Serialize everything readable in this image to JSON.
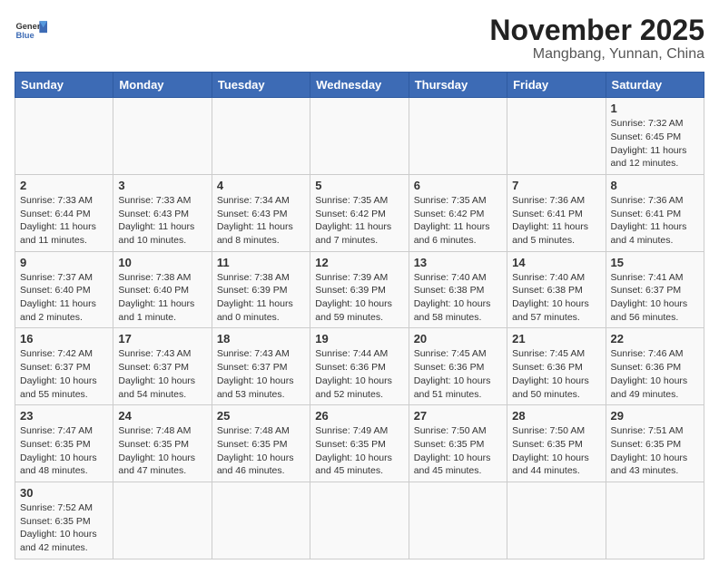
{
  "header": {
    "logo_general": "General",
    "logo_blue": "Blue",
    "month": "November 2025",
    "location": "Mangbang, Yunnan, China"
  },
  "days_of_week": [
    "Sunday",
    "Monday",
    "Tuesday",
    "Wednesday",
    "Thursday",
    "Friday",
    "Saturday"
  ],
  "weeks": [
    [
      {
        "day": "",
        "info": ""
      },
      {
        "day": "",
        "info": ""
      },
      {
        "day": "",
        "info": ""
      },
      {
        "day": "",
        "info": ""
      },
      {
        "day": "",
        "info": ""
      },
      {
        "day": "",
        "info": ""
      },
      {
        "day": "1",
        "info": "Sunrise: 7:32 AM\nSunset: 6:45 PM\nDaylight: 11 hours and 12 minutes."
      }
    ],
    [
      {
        "day": "2",
        "info": "Sunrise: 7:33 AM\nSunset: 6:44 PM\nDaylight: 11 hours and 11 minutes."
      },
      {
        "day": "3",
        "info": "Sunrise: 7:33 AM\nSunset: 6:43 PM\nDaylight: 11 hours and 10 minutes."
      },
      {
        "day": "4",
        "info": "Sunrise: 7:34 AM\nSunset: 6:43 PM\nDaylight: 11 hours and 8 minutes."
      },
      {
        "day": "5",
        "info": "Sunrise: 7:35 AM\nSunset: 6:42 PM\nDaylight: 11 hours and 7 minutes."
      },
      {
        "day": "6",
        "info": "Sunrise: 7:35 AM\nSunset: 6:42 PM\nDaylight: 11 hours and 6 minutes."
      },
      {
        "day": "7",
        "info": "Sunrise: 7:36 AM\nSunset: 6:41 PM\nDaylight: 11 hours and 5 minutes."
      },
      {
        "day": "8",
        "info": "Sunrise: 7:36 AM\nSunset: 6:41 PM\nDaylight: 11 hours and 4 minutes."
      }
    ],
    [
      {
        "day": "9",
        "info": "Sunrise: 7:37 AM\nSunset: 6:40 PM\nDaylight: 11 hours and 2 minutes."
      },
      {
        "day": "10",
        "info": "Sunrise: 7:38 AM\nSunset: 6:40 PM\nDaylight: 11 hours and 1 minute."
      },
      {
        "day": "11",
        "info": "Sunrise: 7:38 AM\nSunset: 6:39 PM\nDaylight: 11 hours and 0 minutes."
      },
      {
        "day": "12",
        "info": "Sunrise: 7:39 AM\nSunset: 6:39 PM\nDaylight: 10 hours and 59 minutes."
      },
      {
        "day": "13",
        "info": "Sunrise: 7:40 AM\nSunset: 6:38 PM\nDaylight: 10 hours and 58 minutes."
      },
      {
        "day": "14",
        "info": "Sunrise: 7:40 AM\nSunset: 6:38 PM\nDaylight: 10 hours and 57 minutes."
      },
      {
        "day": "15",
        "info": "Sunrise: 7:41 AM\nSunset: 6:37 PM\nDaylight: 10 hours and 56 minutes."
      }
    ],
    [
      {
        "day": "16",
        "info": "Sunrise: 7:42 AM\nSunset: 6:37 PM\nDaylight: 10 hours and 55 minutes."
      },
      {
        "day": "17",
        "info": "Sunrise: 7:43 AM\nSunset: 6:37 PM\nDaylight: 10 hours and 54 minutes."
      },
      {
        "day": "18",
        "info": "Sunrise: 7:43 AM\nSunset: 6:37 PM\nDaylight: 10 hours and 53 minutes."
      },
      {
        "day": "19",
        "info": "Sunrise: 7:44 AM\nSunset: 6:36 PM\nDaylight: 10 hours and 52 minutes."
      },
      {
        "day": "20",
        "info": "Sunrise: 7:45 AM\nSunset: 6:36 PM\nDaylight: 10 hours and 51 minutes."
      },
      {
        "day": "21",
        "info": "Sunrise: 7:45 AM\nSunset: 6:36 PM\nDaylight: 10 hours and 50 minutes."
      },
      {
        "day": "22",
        "info": "Sunrise: 7:46 AM\nSunset: 6:36 PM\nDaylight: 10 hours and 49 minutes."
      }
    ],
    [
      {
        "day": "23",
        "info": "Sunrise: 7:47 AM\nSunset: 6:35 PM\nDaylight: 10 hours and 48 minutes."
      },
      {
        "day": "24",
        "info": "Sunrise: 7:48 AM\nSunset: 6:35 PM\nDaylight: 10 hours and 47 minutes."
      },
      {
        "day": "25",
        "info": "Sunrise: 7:48 AM\nSunset: 6:35 PM\nDaylight: 10 hours and 46 minutes."
      },
      {
        "day": "26",
        "info": "Sunrise: 7:49 AM\nSunset: 6:35 PM\nDaylight: 10 hours and 45 minutes."
      },
      {
        "day": "27",
        "info": "Sunrise: 7:50 AM\nSunset: 6:35 PM\nDaylight: 10 hours and 45 minutes."
      },
      {
        "day": "28",
        "info": "Sunrise: 7:50 AM\nSunset: 6:35 PM\nDaylight: 10 hours and 44 minutes."
      },
      {
        "day": "29",
        "info": "Sunrise: 7:51 AM\nSunset: 6:35 PM\nDaylight: 10 hours and 43 minutes."
      }
    ],
    [
      {
        "day": "30",
        "info": "Sunrise: 7:52 AM\nSunset: 6:35 PM\nDaylight: 10 hours and 42 minutes."
      },
      {
        "day": "",
        "info": ""
      },
      {
        "day": "",
        "info": ""
      },
      {
        "day": "",
        "info": ""
      },
      {
        "day": "",
        "info": ""
      },
      {
        "day": "",
        "info": ""
      },
      {
        "day": "",
        "info": ""
      }
    ]
  ]
}
